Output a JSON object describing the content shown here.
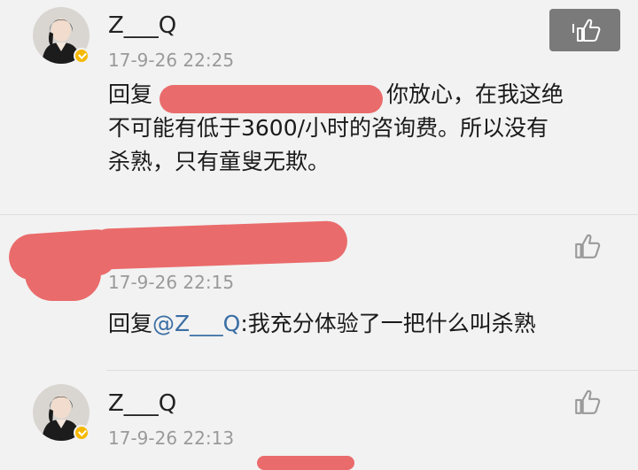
{
  "comments": [
    {
      "user": "Z___Q",
      "time": "17-9-26 22:25",
      "reply_prefix": "回复",
      "line1_after": "你放心，在我这绝",
      "line2": "不可能有低于3600/小时的咨询费。所以没有",
      "line3": "杀熟，只有童叟无欺。",
      "like_state": "active"
    },
    {
      "user": "",
      "time": "17-9-26 22:15",
      "reply_prefix": "回复",
      "mention": "@Z___Q",
      "text_after": ":我充分体验了一把什么叫杀熟",
      "like_state": "normal"
    },
    {
      "user": "Z___Q",
      "time": "17-9-26 22:13",
      "like_state": "normal"
    }
  ],
  "colors": {
    "background": "#f2f2f2",
    "redaction": "#ea6b6b",
    "mention": "#3b6ea5",
    "timestamp": "#9a9a9a",
    "verified_badge": "#f6b800"
  },
  "icons": {
    "like": "thumbs-up-icon",
    "verified": "verified-badge-icon"
  }
}
